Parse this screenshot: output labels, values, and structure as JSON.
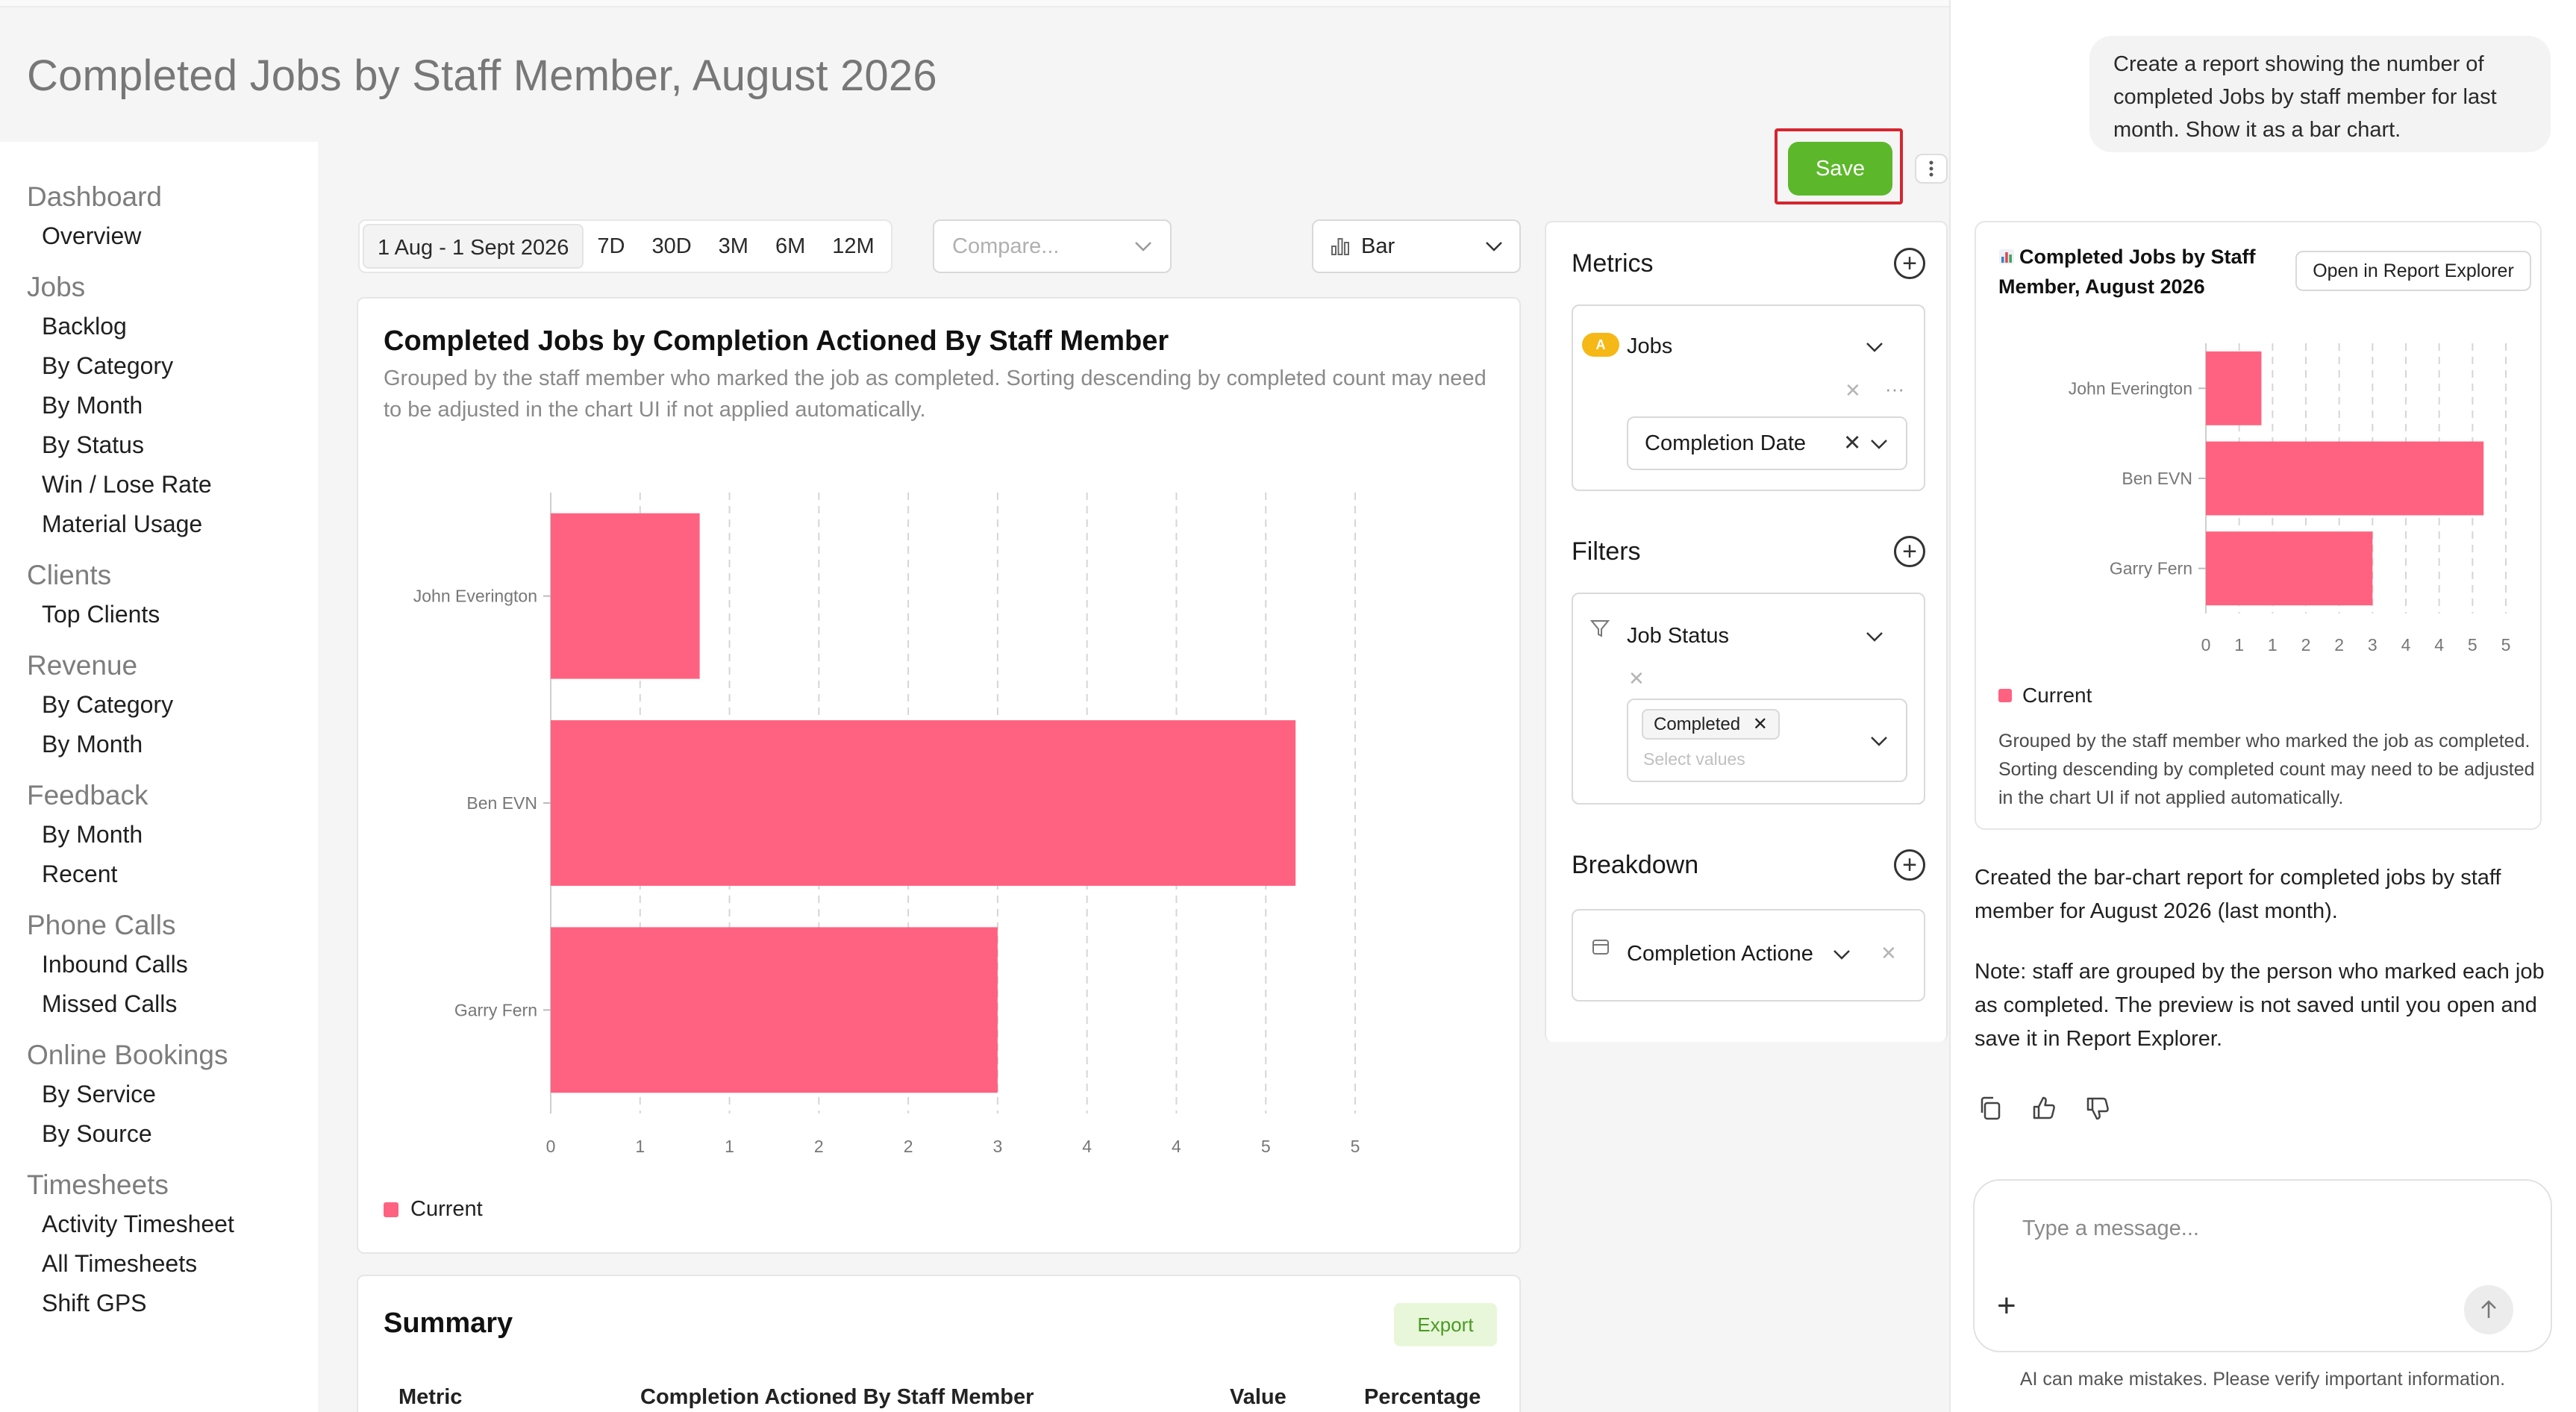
{
  "page": {
    "title": "Completed Jobs by Staff Member, August 2026"
  },
  "sidebar": {
    "groups": [
      {
        "heading": "Dashboard",
        "items": [
          "Overview"
        ]
      },
      {
        "heading": "Jobs",
        "items": [
          "Backlog",
          "By Category",
          "By Month",
          "By Status",
          "Win / Lose Rate",
          "Material Usage"
        ]
      },
      {
        "heading": "Clients",
        "items": [
          "Top Clients"
        ]
      },
      {
        "heading": "Revenue",
        "items": [
          "By Category",
          "By Month"
        ]
      },
      {
        "heading": "Feedback",
        "items": [
          "By Month",
          "Recent"
        ]
      },
      {
        "heading": "Phone Calls",
        "items": [
          "Inbound Calls",
          "Missed Calls"
        ]
      },
      {
        "heading": "Online Bookings",
        "items": [
          "By Service",
          "By Source"
        ]
      },
      {
        "heading": "Timesheets",
        "items": [
          "Activity Timesheet",
          "All Timesheets",
          "Shift GPS"
        ]
      }
    ]
  },
  "toolbar": {
    "save_label": "Save",
    "more_icon": "kebab-icon",
    "ranges": [
      "1 Aug - 1 Sept 2026",
      "7D",
      "30D",
      "3M",
      "6M",
      "12M"
    ],
    "active_range": "1 Aug - 1 Sept 2026",
    "compare_placeholder": "Compare...",
    "chart_type_label": "Bar",
    "chart_type_icon": "bar-chart-icon"
  },
  "chart_card": {
    "title": "Completed Jobs by Completion Actioned By Staff Member",
    "subtitle": "Grouped by the staff member who marked the job as completed. Sorting descending by completed count may need to be adjusted in the chart UI if not applied automatically.",
    "legend_label": "Current"
  },
  "chart_data": {
    "type": "bar",
    "orientation": "horizontal",
    "categories": [
      "John Everington",
      "Ben EVN",
      "Garry Fern"
    ],
    "series": [
      {
        "name": "Current",
        "values": [
          1,
          5,
          3
        ],
        "color": "#ff6280"
      }
    ],
    "xtick_labels": [
      "0",
      "1",
      "1",
      "2",
      "2",
      "3",
      "4",
      "4",
      "5",
      "5"
    ],
    "xlim": [
      0,
      5.4
    ],
    "grid": true,
    "legend": "bottom-left"
  },
  "summary": {
    "title": "Summary",
    "export_label": "Export",
    "columns": [
      "Metric",
      "Completion Actioned By Staff Member",
      "Value",
      "Percentage"
    ]
  },
  "config": {
    "metrics": {
      "title": "Metrics",
      "badge": "A",
      "metric_label": "Jobs",
      "date_field": "Completion Date"
    },
    "filters": {
      "title": "Filters",
      "filter_label": "Job Status",
      "selected_tag": "Completed",
      "values_placeholder": "Select values"
    },
    "breakdown": {
      "title": "Breakdown",
      "field_label": "Completion Actione"
    }
  },
  "chat": {
    "user_message": "Create a report showing the number of completed Jobs by staff member for last month. Show it as a bar chart.",
    "preview": {
      "icon": "bar-chart-emoji-icon",
      "title": "Completed Jobs by Staff Member, August 2026",
      "open_label": "Open in Report Explorer",
      "legend_label": "Current",
      "note": "Grouped by the staff member who marked the job as completed. Sorting descending by completed count may need to be adjusted in the chart UI if not applied automatically."
    },
    "assistant_message_1": "Created the bar-chart report for completed jobs by staff member for August 2026 (last month).",
    "assistant_message_2": "Note: staff are grouped by the person who marked each job as completed. The preview is not saved until you open and save it in Report Explorer.",
    "input_placeholder": "Type a message...",
    "disclaimer": "AI can make mistakes. Please verify important information."
  }
}
